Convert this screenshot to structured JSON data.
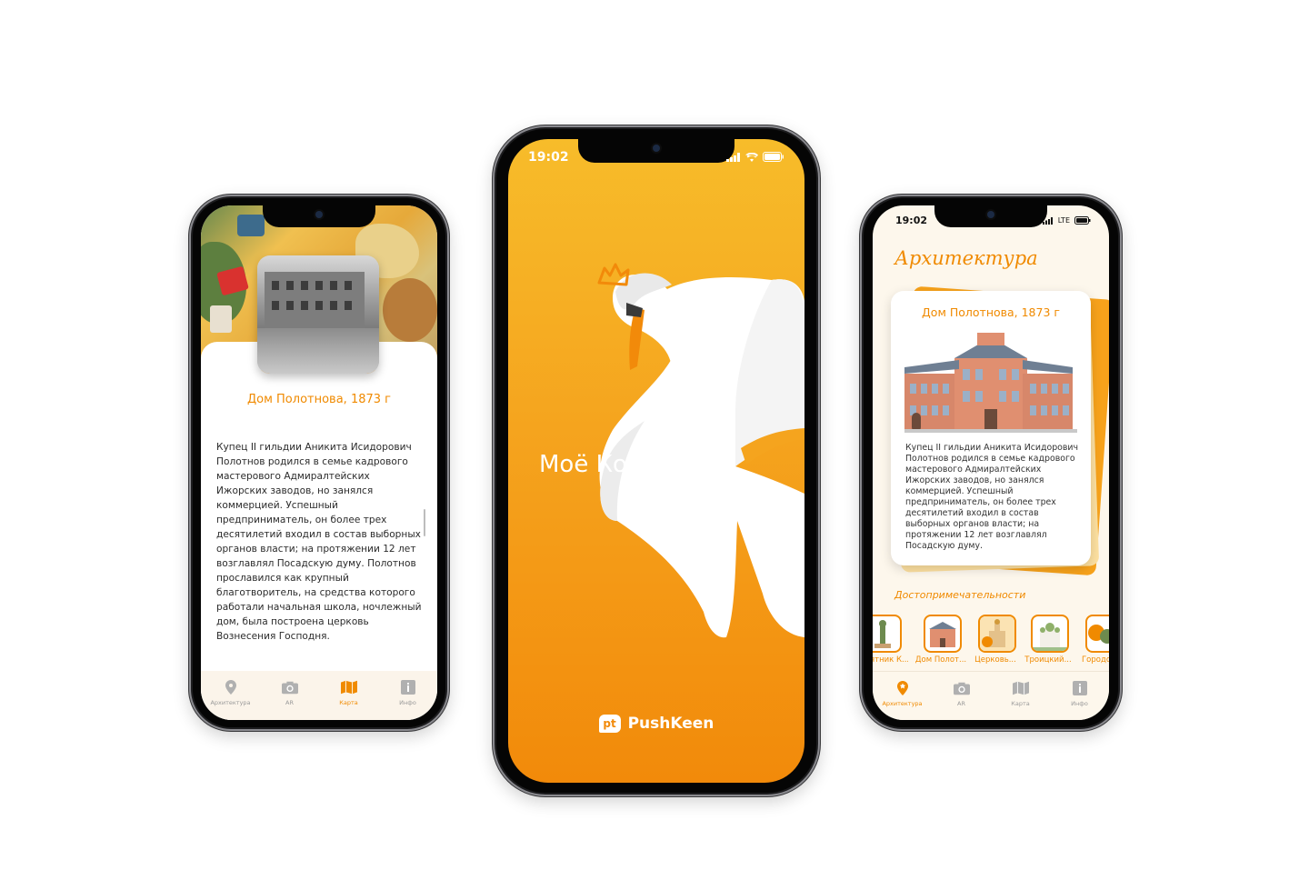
{
  "phone_left": {
    "card_title": "Дом Полотнова, 1873 г",
    "body_text": "Купец II гильдии Аникита Исидорович Полотнов родился в семье кадрового мастерового Адмиралтейских Ижорских заводов, но занялся коммерцией. Успешный предприниматель, он более трех десятилетий входил в состав выборных органов власти; на протяжении 12 лет возглавлял Посадскую думу. Полотнов прославился как крупный благотворитель, на средства которого работали начальная школа, ночлежный дом, была построена церковь Вознесения Господня.",
    "tabs": [
      {
        "label": "Архитектура",
        "icon": "location-pin-icon",
        "active": false
      },
      {
        "label": "AR",
        "icon": "camera-icon",
        "active": false
      },
      {
        "label": "Карта",
        "icon": "map-icon",
        "active": true
      },
      {
        "label": "Инфо",
        "icon": "info-icon",
        "active": false
      }
    ]
  },
  "phone_center": {
    "status_time": "19:02",
    "app_title": "Моё Колпино",
    "brand": "PushKeen",
    "brand_logo_text": "pt"
  },
  "phone_right": {
    "status_time": "19:02",
    "network": "LTE",
    "section_title": "Архитектура",
    "card_title": "Дом Полотнова, 1873 г",
    "card_text": "Купец II гильдии Аникита Исидорович Полотнов родился в семье кадрового мастерового Адмиралтейских Ижорских заводов, но занялся коммерцией. Успешный предприниматель, он более трех десятилетий входил в состав выборных органов власти; на протяжении 12 лет возглавлял Посадскую думу.",
    "sights_label": "Достопримечательности",
    "thumbs": [
      "Памятник К...",
      "Дом Полот...",
      "Церковь...",
      "Троицкий...",
      "Городс..."
    ],
    "tabs": [
      {
        "label": "Архитектура",
        "icon": "location-pin-icon",
        "active": true
      },
      {
        "label": "AR",
        "icon": "camera-icon",
        "active": false
      },
      {
        "label": "Карта",
        "icon": "map-icon",
        "active": false
      },
      {
        "label": "Инфо",
        "icon": "info-icon",
        "active": false
      }
    ]
  },
  "colors": {
    "accent": "#f08a00",
    "splash_top": "#f7bc2a",
    "splash_bottom": "#f28a0a",
    "card_bg": "#fdf7ec"
  }
}
